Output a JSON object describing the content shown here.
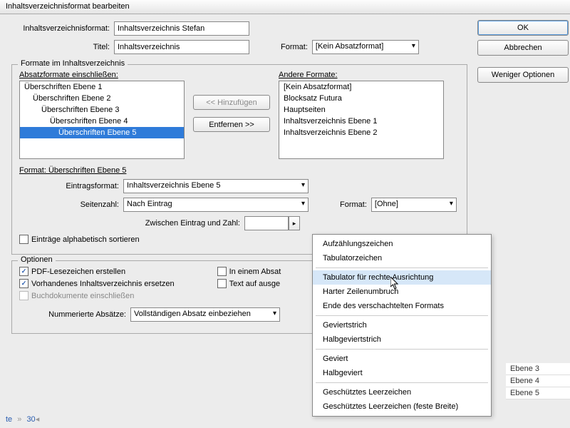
{
  "window": {
    "title": "Inhaltsverzeichnisformat bearbeiten"
  },
  "header": {
    "tocFormatLabel": "Inhaltsverzeichnisformat:",
    "tocFormatValue": "Inhaltsverzeichnis Stefan",
    "titleLabel": "Titel:",
    "titleValue": "Inhaltsverzeichnis",
    "formatLabel": "Format:",
    "formatValue": "[Kein Absatzformat]"
  },
  "buttons": {
    "ok": "OK",
    "cancel": "Abbrechen",
    "lessOptions": "Weniger Optionen",
    "add": "<< Hinzufügen",
    "remove": "Entfernen >>"
  },
  "stylesGroup": {
    "legend": "Formate im Inhaltsverzeichnis",
    "includeLabel": "Absatzformate einschließen:",
    "otherLabel": "Andere Formate:",
    "include": [
      "Überschriften Ebene 1",
      "Überschriften Ebene 2",
      "Überschriften Ebene 3",
      "Überschriften Ebene 4",
      "Überschriften Ebene 5"
    ],
    "other": [
      "[Kein Absatzformat]",
      "Blocksatz Futura",
      "Hauptseiten",
      "Inhaltsverzeichnis Ebene 1",
      "Inhaltsverzeichnis Ebene 2"
    ],
    "formatSub": {
      "heading": "Format: Überschriften Ebene 5",
      "entryFormatLabel": "Eintragsformat:",
      "entryFormatValue": "Inhaltsverzeichnis Ebene 5",
      "pageNumLabel": "Seitenzahl:",
      "pageNumValue": "Nach Eintrag",
      "formatLabel": "Format:",
      "formatValue": "[Ohne]",
      "betweenLabel": "Zwischen Eintrag und Zahl:",
      "betweenValue": "",
      "sortAlpha": "Einträge alphabetisch sortieren"
    }
  },
  "options": {
    "legend": "Optionen",
    "pdf": "PDF-Lesezeichen erstellen",
    "replace": "Vorhandenes Inhaltsverzeichnis ersetzen",
    "book": "Buchdokumente einschließen",
    "inFrame": "In einem Absat",
    "textOnHidden": "Text auf ausge",
    "numberedLabel": "Nummerierte Absätze:",
    "numberedValue": "Vollständigen Absatz einbeziehen"
  },
  "flyout": {
    "items": [
      "Aufzählungszeichen",
      "Tabulatorzeichen",
      "Tabulator für rechte Ausrichtung",
      "Harter Zeilenumbruch",
      "Ende des verschachtelten Formats",
      "Geviertstrich",
      "Halbgeviertstrich",
      "Geviert",
      "Halbgeviert",
      "Geschütztes Leerzeichen",
      "Geschütztes Leerzeichen (feste Breite)"
    ],
    "hover": 2,
    "sepAfter": [
      1,
      4,
      6,
      8
    ]
  },
  "bgList": [
    "Ebene 3",
    "Ebene 4",
    "Ebene 5"
  ],
  "pagebar": {
    "prefix": "te",
    "sep": "»",
    "page": "30"
  }
}
